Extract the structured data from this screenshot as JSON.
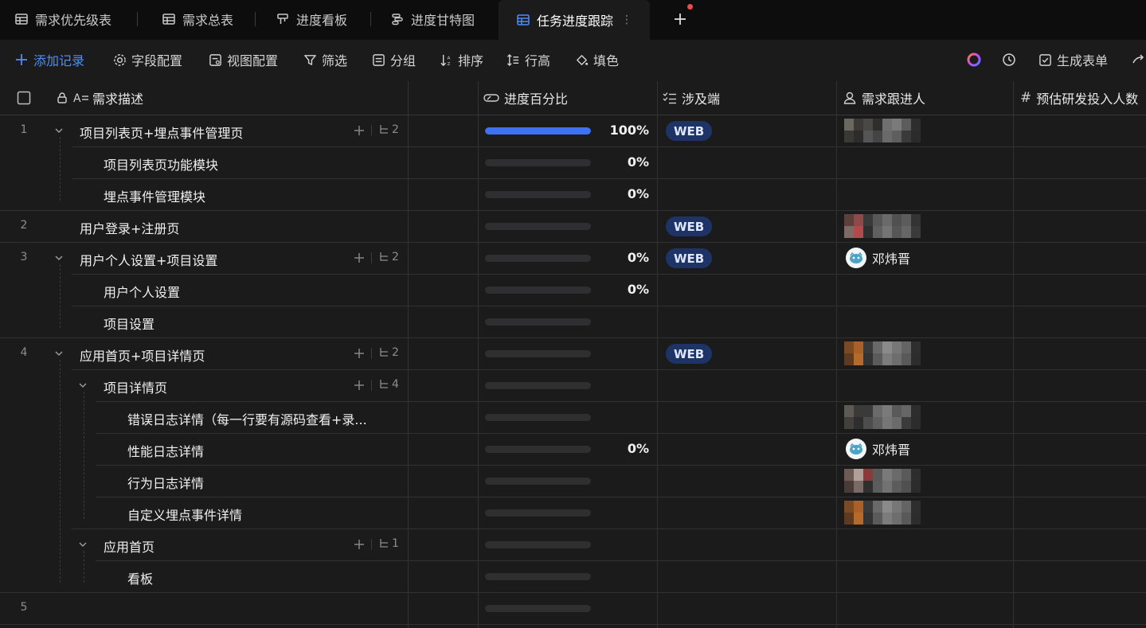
{
  "tabs": [
    {
      "label": "需求优先级表",
      "icon": "table-icon"
    },
    {
      "label": "需求总表",
      "icon": "table-icon"
    },
    {
      "label": "进度看板",
      "icon": "kanban-icon"
    },
    {
      "label": "进度甘特图",
      "icon": "gantt-icon"
    },
    {
      "label": "任务进度跟踪",
      "icon": "table-icon",
      "active": true
    }
  ],
  "toolbar": {
    "add_record": "添加记录",
    "field_config": "字段配置",
    "view_config": "视图配置",
    "filter": "筛选",
    "group": "分组",
    "sort": "排序",
    "row_height": "行高",
    "fill_color": "填色",
    "generate_form": "生成表单"
  },
  "columns": {
    "description": "需求描述",
    "progress": "进度百分比",
    "platform": "涉及端",
    "assignee": "需求跟进人",
    "estimate": "预估研发投入人数"
  },
  "colors": {
    "accent": "#4c8dff",
    "progress_fill": "#3e72f2",
    "badge_bg": "#1e3466"
  },
  "rows": [
    {
      "num": "1",
      "title": "项目列表页+埋点事件管理页",
      "expand": true,
      "subcount": "2",
      "progress": 1.0,
      "pct": "100%",
      "platform": "WEB",
      "assignee": "blurred"
    },
    {
      "num": "",
      "title": "项目列表页功能模块",
      "progress": 0,
      "pct": "0%"
    },
    {
      "num": "",
      "title": "埋点事件管理模块",
      "progress": 0,
      "pct": "0%"
    },
    {
      "num": "2",
      "title": "用户登录+注册页",
      "progress": 0,
      "pct": "",
      "platform": "WEB",
      "assignee": "blurred"
    },
    {
      "num": "3",
      "title": "用户个人设置+项目设置",
      "expand": true,
      "subcount": "2",
      "progress": 0,
      "pct": "0%",
      "platform": "WEB",
      "assignee": "邓炜晋"
    },
    {
      "num": "",
      "title": "用户个人设置",
      "progress": 0,
      "pct": "0%"
    },
    {
      "num": "",
      "title": "项目设置",
      "progress": 0,
      "pct": ""
    },
    {
      "num": "4",
      "title": "应用首页+项目详情页",
      "expand": true,
      "subcount": "2",
      "progress": 0,
      "pct": "",
      "platform": "WEB",
      "assignee": "blurred"
    },
    {
      "num": "",
      "title": "项目详情页",
      "expand": true,
      "subcount": "4",
      "progress": 0,
      "pct": ""
    },
    {
      "num": "",
      "title": "错误日志详情（每一行要有源码查看+录...",
      "progress": 0,
      "pct": "",
      "assignee": "blurred"
    },
    {
      "num": "",
      "title": "性能日志详情",
      "progress": 0,
      "pct": "0%",
      "assignee": "邓炜晋"
    },
    {
      "num": "",
      "title": "行为日志详情",
      "progress": 0,
      "pct": "",
      "assignee": "blurred"
    },
    {
      "num": "",
      "title": "自定义埋点事件详情",
      "progress": 0,
      "pct": "",
      "assignee": "blurred"
    },
    {
      "num": "",
      "title": "应用首页",
      "expand": true,
      "subcount": "1",
      "progress": 0,
      "pct": ""
    },
    {
      "num": "",
      "title": "看板",
      "progress": 0,
      "pct": ""
    },
    {
      "num": "5",
      "title": "",
      "progress": 0,
      "pct": ""
    }
  ]
}
